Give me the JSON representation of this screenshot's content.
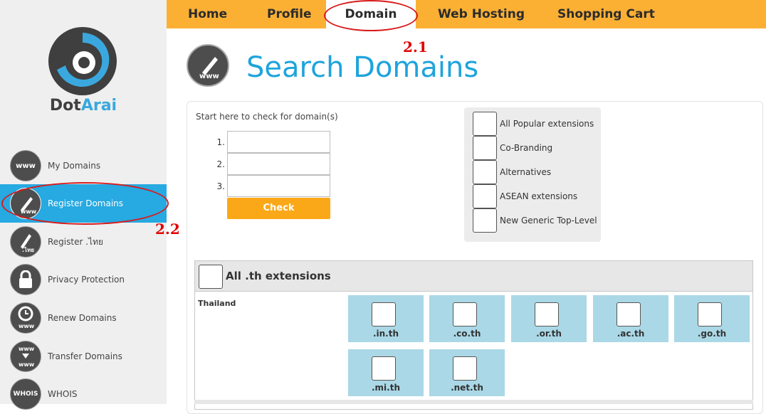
{
  "brand": {
    "part1": "Dot",
    "part2": "Arai"
  },
  "nav": {
    "items": [
      "Home",
      "Profile",
      "Domain",
      "Web Hosting",
      "Shopping Cart"
    ],
    "active": "Domain"
  },
  "sidebar": {
    "items": [
      {
        "label": "My Domains",
        "icon": "www-icon",
        "icon_text": "www"
      },
      {
        "label": "Register Domains",
        "icon": "pen-www-icon",
        "icon_text": "www"
      },
      {
        "label": "Register .ไทย",
        "icon": "pen-thai-icon",
        "icon_text": ".ไทย"
      },
      {
        "label": "Privacy Protection",
        "icon": "lock-icon",
        "icon_text": ""
      },
      {
        "label": "Renew Domains",
        "icon": "clock-www-icon",
        "icon_text": "www"
      },
      {
        "label": "Transfer Domains",
        "icon": "transfer-www-icon",
        "icon_text": "www"
      },
      {
        "label": "WHOIS",
        "icon": "whois-icon",
        "icon_text": "WHOIS"
      }
    ],
    "active_index": 1
  },
  "annotations": {
    "nav_marker": "2.1",
    "sidebar_marker": "2.2"
  },
  "page": {
    "title": "Search Domains",
    "icon_text": "www",
    "intro": "Start here to check for domain(s)",
    "row_numbers": [
      "1.",
      "2.",
      "3."
    ],
    "inputs": [
      "",
      "",
      ""
    ],
    "check_button": "Check"
  },
  "extension_groups": [
    "All Popular extensions",
    "Co-Branding",
    "Alternatives",
    "ASEAN extensions",
    "New Generic Top-Level"
  ],
  "th_section": {
    "title": "All .th extensions",
    "country": "Thailand",
    "tlds": [
      ".in.th",
      ".co.th",
      ".or.th",
      ".ac.th",
      ".go.th",
      ".mi.th",
      ".net.th"
    ]
  },
  "colors": {
    "nav_bg": "#fbb034",
    "accent_blue": "#1ea4dc",
    "active_sidebar": "#27a9e1",
    "check_button": "#fba818",
    "tld_tile": "#aad8e6",
    "annotation": "#e00000"
  }
}
